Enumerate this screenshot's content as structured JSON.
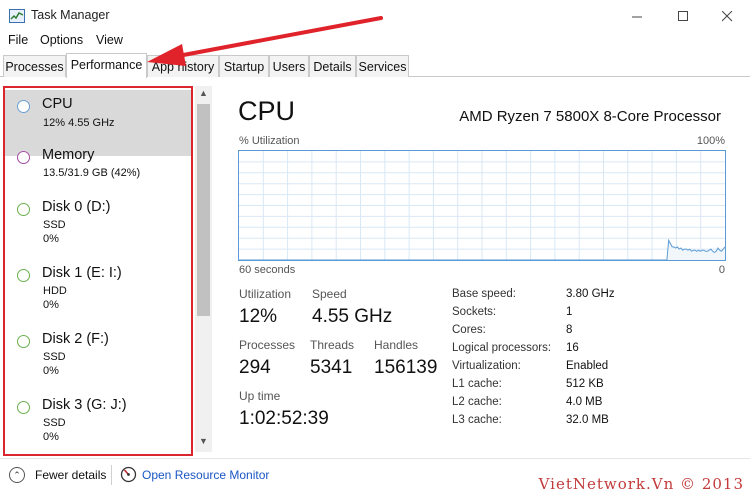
{
  "window": {
    "title": "Task Manager"
  },
  "menu": {
    "file": "File",
    "options": "Options",
    "view": "View"
  },
  "tabs": [
    {
      "label": "Processes",
      "active": false
    },
    {
      "label": "Performance",
      "active": true
    },
    {
      "label": "App history",
      "active": false
    },
    {
      "label": "Startup",
      "active": false
    },
    {
      "label": "Users",
      "active": false
    },
    {
      "label": "Details",
      "active": false
    },
    {
      "label": "Services",
      "active": false
    }
  ],
  "sidebar": {
    "items": [
      {
        "name": "CPU",
        "sub1": "12%  4.55 GHz",
        "sub2": "",
        "circle_color": "#6a9fd4",
        "selected": true
      },
      {
        "name": "Memory",
        "sub1": "13.5/31.9 GB (42%)",
        "sub2": "",
        "circle_color": "#a64ca6",
        "selected": false
      },
      {
        "name": "Disk 0 (D:)",
        "sub1": "SSD",
        "sub2": "0%",
        "circle_color": "#6ab04c",
        "selected": false
      },
      {
        "name": "Disk 1 (E: I:)",
        "sub1": "HDD",
        "sub2": "0%",
        "circle_color": "#6ab04c",
        "selected": false
      },
      {
        "name": "Disk 2 (F:)",
        "sub1": "SSD",
        "sub2": "0%",
        "circle_color": "#6ab04c",
        "selected": false
      },
      {
        "name": "Disk 3 (G: J:)",
        "sub1": "SSD",
        "sub2": "0%",
        "circle_color": "#6ab04c",
        "selected": false
      }
    ]
  },
  "main": {
    "title": "CPU",
    "cpu_name": "AMD Ryzen 7 5800X 8-Core Processor",
    "util_label": "% Utilization",
    "util_max": "100%",
    "x_left": "60 seconds",
    "x_right": "0",
    "stats": {
      "utilization_label": "Utilization",
      "utilization_value": "12%",
      "speed_label": "Speed",
      "speed_value": "4.55 GHz",
      "processes_label": "Processes",
      "processes_value": "294",
      "threads_label": "Threads",
      "threads_value": "5341",
      "handles_label": "Handles",
      "handles_value": "156139",
      "uptime_label": "Up time",
      "uptime_value": "1:02:52:39"
    },
    "specs": [
      {
        "label": "Base speed:",
        "value": "3.80 GHz"
      },
      {
        "label": "Sockets:",
        "value": "1"
      },
      {
        "label": "Cores:",
        "value": "8"
      },
      {
        "label": "Logical processors:",
        "value": "16"
      },
      {
        "label": "Virtualization:",
        "value": "Enabled"
      },
      {
        "label": "L1 cache:",
        "value": "512 KB"
      },
      {
        "label": "L2 cache:",
        "value": "4.0 MB"
      },
      {
        "label": "L3 cache:",
        "value": "32.0 MB"
      }
    ],
    "graph_values": [
      0,
      0,
      0,
      0,
      0,
      0,
      0,
      0,
      0,
      0,
      0,
      0,
      0,
      0,
      0,
      0,
      0,
      0,
      0,
      0,
      0,
      0,
      0,
      0,
      0,
      0,
      0,
      0,
      0,
      0,
      0,
      0,
      0,
      0,
      0,
      0,
      0,
      0,
      0,
      0,
      0,
      0,
      0,
      0,
      0,
      0,
      0,
      0,
      0,
      0,
      0,
      0,
      0,
      0,
      0,
      0,
      0,
      0,
      0,
      0,
      0,
      0,
      0,
      0,
      0,
      0,
      0,
      0,
      0,
      0,
      0,
      0,
      0,
      0,
      0,
      0,
      0,
      0,
      0,
      0,
      0,
      0,
      0,
      0,
      0,
      0,
      0,
      0,
      0,
      0,
      0,
      0,
      0,
      0,
      0,
      0,
      0,
      0,
      0,
      0,
      0,
      0,
      0,
      0,
      0,
      0,
      0,
      0,
      0,
      0,
      0,
      0,
      0,
      0,
      0,
      0,
      0,
      0,
      0,
      0,
      0,
      0,
      0,
      0,
      0,
      0,
      0,
      0,
      0,
      0,
      0,
      0,
      0,
      0,
      0,
      0,
      0,
      0,
      0,
      0,
      0,
      0,
      0,
      0,
      0,
      0,
      0,
      0,
      0,
      0,
      0,
      0,
      0,
      0,
      0,
      0,
      0,
      0,
      0,
      0,
      0,
      0,
      0,
      0,
      0,
      0,
      0,
      0,
      0,
      0,
      0,
      0,
      0,
      0,
      0,
      0,
      0,
      0,
      0,
      0,
      0,
      0,
      0,
      0,
      0,
      0,
      0,
      0,
      0,
      0,
      0,
      0,
      0,
      0,
      0,
      0,
      0,
      0,
      0,
      0,
      0,
      0,
      0,
      0,
      0,
      0,
      0,
      0,
      0,
      0,
      0,
      0,
      0,
      0,
      0,
      0,
      0,
      0,
      0,
      0,
      0,
      0,
      0,
      0,
      0,
      0,
      0,
      0,
      0,
      0,
      0,
      0,
      0,
      0,
      0,
      0,
      0,
      0,
      0,
      0,
      0,
      0,
      0,
      0,
      18,
      15,
      12,
      12,
      11,
      12,
      10,
      11,
      9,
      10,
      10,
      9,
      10,
      8,
      9,
      9,
      8,
      9,
      8,
      9,
      9,
      8,
      8,
      9,
      10,
      8,
      7,
      8,
      11,
      9,
      8,
      10,
      12
    ]
  },
  "footer": {
    "fewer_details": "Fewer details",
    "resource_monitor": "Open Resource Monitor",
    "watermark": "VietNetwork.Vn © 2013"
  },
  "colors": {
    "accent": "#5b9bd5",
    "highlight_box": "#d9262c",
    "arrow": "#e0232a"
  }
}
